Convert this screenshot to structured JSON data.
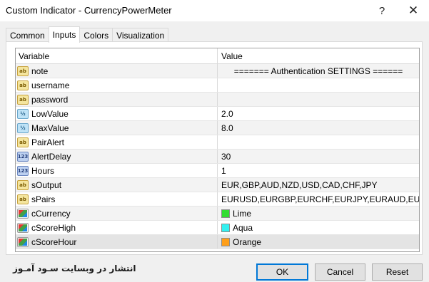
{
  "window": {
    "title": "Custom Indicator - CurrencyPowerMeter",
    "help_label": "?",
    "close_label": "✕"
  },
  "tabs": [
    {
      "label": "Common"
    },
    {
      "label": "Inputs"
    },
    {
      "label": "Colors"
    },
    {
      "label": "Visualization"
    }
  ],
  "table": {
    "headers": {
      "variable": "Variable",
      "value": "Value"
    },
    "rows": [
      {
        "name": "note",
        "value": "======= Authentication SETTINGS ======",
        "icon": "ab"
      },
      {
        "name": "username",
        "value": "",
        "icon": "ab"
      },
      {
        "name": "password",
        "value": "",
        "icon": "ab"
      },
      {
        "name": "LowValue",
        "value": "2.0",
        "icon": "frac"
      },
      {
        "name": "MaxValue",
        "value": "8.0",
        "icon": "frac"
      },
      {
        "name": "PairAlert",
        "value": "",
        "icon": "ab"
      },
      {
        "name": "AlertDelay",
        "value": "30",
        "icon": "num"
      },
      {
        "name": "Hours",
        "value": "1",
        "icon": "num"
      },
      {
        "name": "sOutput",
        "value": "EUR,GBP,AUD,NZD,USD,CAD,CHF,JPY",
        "icon": "ab"
      },
      {
        "name": "sPairs",
        "value": "EURUSD,EURGBP,EURCHF,EURJPY,EURAUD,EUR...",
        "icon": "ab"
      },
      {
        "name": "cCurrency",
        "value": "Lime",
        "icon": "color",
        "swatch": "#33dd33"
      },
      {
        "name": "cScoreHigh",
        "value": "Aqua",
        "icon": "color",
        "swatch": "#33f0f0"
      },
      {
        "name": "cScoreHour",
        "value": "Orange",
        "icon": "color",
        "swatch": "#ff9f1a"
      }
    ]
  },
  "icons": {
    "ab": "ab",
    "frac": "½",
    "num": "123"
  },
  "footer": {
    "watermark": "انتشار در وبسایت سـود آمـوز",
    "ok_label": "OK",
    "cancel_label": "Cancel",
    "reset_label": "Reset"
  },
  "colors": {
    "accent": "#0078d7",
    "lime": "#33dd33",
    "aqua": "#33f0f0",
    "orange": "#ff9f1a"
  }
}
